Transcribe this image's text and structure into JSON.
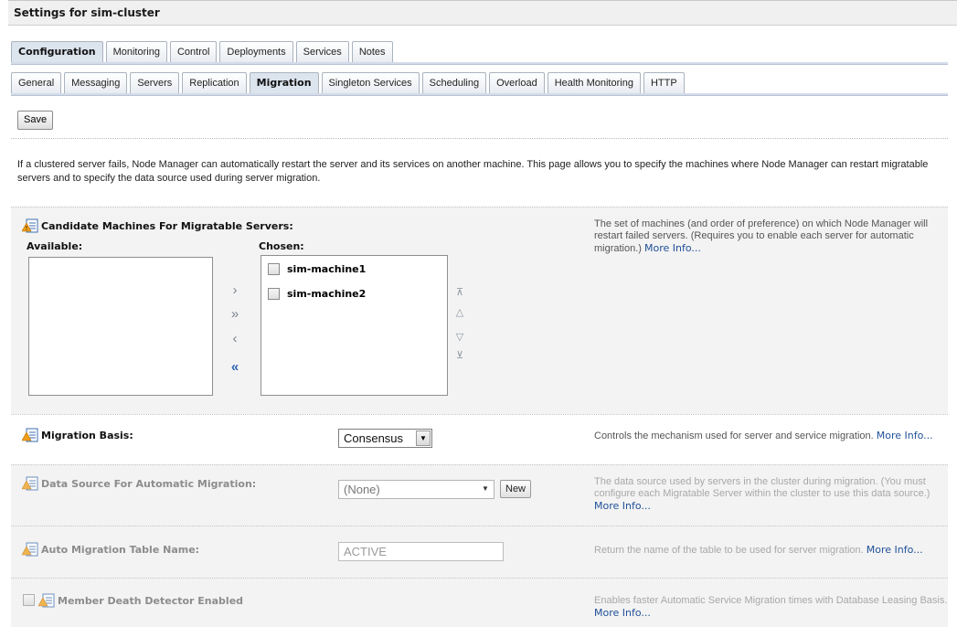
{
  "page": {
    "title": "Settings for sim-cluster"
  },
  "primary_tabs": [
    "Configuration",
    "Monitoring",
    "Control",
    "Deployments",
    "Services",
    "Notes"
  ],
  "secondary_tabs": [
    "General",
    "Messaging",
    "Servers",
    "Replication",
    "Migration",
    "Singleton Services",
    "Scheduling",
    "Overload",
    "Health Monitoring",
    "HTTP"
  ],
  "toolbar": {
    "save_label": "Save"
  },
  "intro": "If a clustered server fails, Node Manager can automatically restart the server and its services on another machine. This page allows you to specify the machines where Node Manager can restart migratable servers and to specify the data source used during server migration.",
  "candidates": {
    "label": "Candidate Machines For Migratable Servers:",
    "available_label": "Available:",
    "chosen_label": "Chosen:",
    "chosen_items": [
      "sim-machine1",
      "sim-machine2"
    ],
    "help": "The set of machines (and order of preference) on which Node Manager will restart failed servers. (Requires you to enable each server for automatic migration.)",
    "more": "More Info..."
  },
  "migration_basis": {
    "label": "Migration Basis:",
    "value": "Consensus",
    "help": "Controls the mechanism used for server and service migration.",
    "more": "More Info..."
  },
  "data_source": {
    "label": "Data Source For Automatic Migration:",
    "value": "(None)",
    "new_label": "New",
    "help": "The data source used by servers in the cluster during migration. (You must configure each Migratable Server within the cluster to use this data source.)",
    "more": "More Info..."
  },
  "table_name": {
    "label": "Auto Migration Table Name:",
    "value": "ACTIVE",
    "help": "Return the name of the table to be used for server migration.",
    "more": "More Info..."
  },
  "death_detector": {
    "label": "Member Death Detector Enabled",
    "help": "Enables faster Automatic Service Migration times with Database Leasing Basis.",
    "more": "More Info..."
  }
}
